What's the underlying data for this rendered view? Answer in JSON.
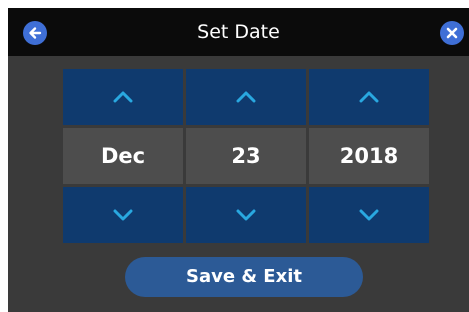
{
  "header": {
    "title": "Set Date",
    "back_icon": "arrow-left-icon",
    "close_icon": "close-icon"
  },
  "picker": {
    "month": "Dec",
    "day": "23",
    "year": "2018",
    "up_icon": "chevron-up-icon",
    "down_icon": "chevron-down-icon"
  },
  "actions": {
    "save_label": "Save & Exit"
  },
  "colors": {
    "title_bar": "#0b0b0b",
    "panel_bg": "#3a3a3a",
    "arrow_cell": "#0f3a6e",
    "value_cell": "#4d4d4d",
    "accent_icon": "#3f6fd6",
    "chevron": "#29a8e0",
    "save_button": "#2c5a96"
  }
}
